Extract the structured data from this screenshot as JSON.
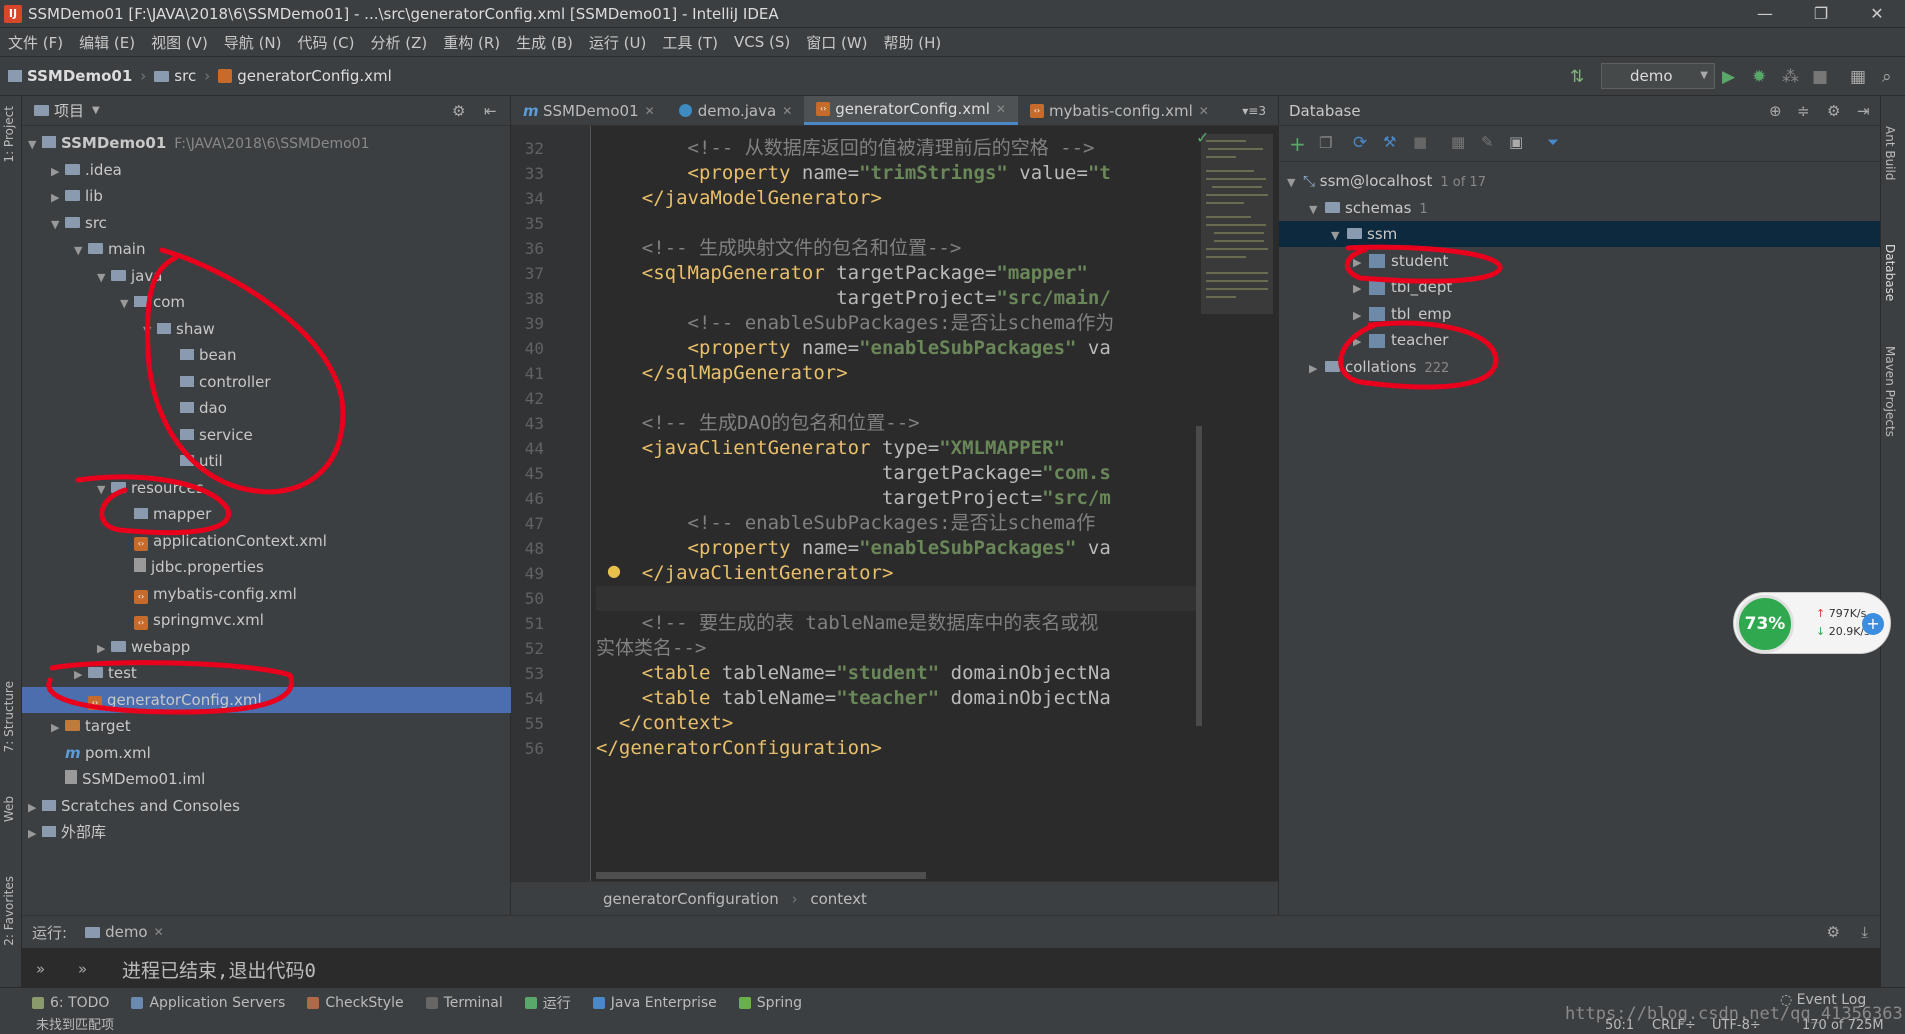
{
  "titlebar": {
    "icon": "IJ",
    "title": "SSMDemo01 [F:\\JAVA\\2018\\6\\SSMDemo01] - ...\\src\\generatorConfig.xml [SSMDemo01] - IntelliJ IDEA",
    "minimize": "—",
    "maximize": "❐",
    "close": "✕"
  },
  "menubar": [
    "文件 (F)",
    "编辑 (E)",
    "视图 (V)",
    "导航 (N)",
    "代码 (C)",
    "分析 (Z)",
    "重构 (R)",
    "生成 (B)",
    "运行 (U)",
    "工具 (T)",
    "VCS (S)",
    "窗口 (W)",
    "帮助 (H)"
  ],
  "navbar": {
    "crumbs": [
      "SSMDemo01",
      "src",
      "generatorConfig.xml"
    ],
    "run_config": "demo"
  },
  "left_stripe": {
    "project": "1: Project",
    "structure": "7: Structure",
    "web": "Web",
    "favorites": "2: Favorites"
  },
  "project_panel": {
    "title": "项目",
    "tree": [
      {
        "label": "SSMDemo01",
        "extra": "F:\\JAVA\\2018\\6\\SSMDemo01",
        "depth": 0,
        "arrow": "▼",
        "icon": "project-folder"
      },
      {
        "label": ".idea",
        "depth": 1,
        "arrow": "▶",
        "icon": "folder"
      },
      {
        "label": "lib",
        "depth": 1,
        "arrow": "▶",
        "icon": "folder"
      },
      {
        "label": "src",
        "depth": 1,
        "arrow": "▼",
        "icon": "folder"
      },
      {
        "label": "main",
        "depth": 2,
        "arrow": "▼",
        "icon": "folder"
      },
      {
        "label": "java",
        "depth": 3,
        "arrow": "▼",
        "icon": "folder"
      },
      {
        "label": "com",
        "depth": 4,
        "arrow": "▼",
        "icon": "package"
      },
      {
        "label": "shaw",
        "depth": 5,
        "arrow": "▼",
        "icon": "package"
      },
      {
        "label": "bean",
        "depth": 6,
        "arrow": "",
        "icon": "package"
      },
      {
        "label": "controller",
        "depth": 6,
        "arrow": "",
        "icon": "package"
      },
      {
        "label": "dao",
        "depth": 6,
        "arrow": "",
        "icon": "package"
      },
      {
        "label": "service",
        "depth": 6,
        "arrow": "",
        "icon": "package"
      },
      {
        "label": "util",
        "depth": 6,
        "arrow": "",
        "icon": "package"
      },
      {
        "label": "resources",
        "depth": 3,
        "arrow": "▼",
        "icon": "folder"
      },
      {
        "label": "mapper",
        "depth": 4,
        "arrow": "",
        "icon": "package"
      },
      {
        "label": "applicationContext.xml",
        "depth": 4,
        "arrow": "",
        "icon": "xml"
      },
      {
        "label": "jdbc.properties",
        "depth": 4,
        "arrow": "",
        "icon": "file"
      },
      {
        "label": "mybatis-config.xml",
        "depth": 4,
        "arrow": "",
        "icon": "xml"
      },
      {
        "label": "springmvc.xml",
        "depth": 4,
        "arrow": "",
        "icon": "xml"
      },
      {
        "label": "webapp",
        "depth": 3,
        "arrow": "▶",
        "icon": "folder"
      },
      {
        "label": "test",
        "depth": 2,
        "arrow": "▶",
        "icon": "folder"
      },
      {
        "label": "generatorConfig.xml",
        "depth": 2,
        "arrow": "",
        "icon": "xml",
        "selected": true
      },
      {
        "label": "target",
        "depth": 1,
        "arrow": "▶",
        "icon": "folder-orange"
      },
      {
        "label": "pom.xml",
        "depth": 1,
        "arrow": "",
        "icon": "maven"
      },
      {
        "label": "SSMDemo01.iml",
        "depth": 1,
        "arrow": "",
        "icon": "file"
      },
      {
        "label": "Scratches and Consoles",
        "depth": 0,
        "arrow": "▶",
        "icon": "scratches"
      },
      {
        "label": "外部库",
        "depth": 0,
        "arrow": "▶",
        "icon": "library"
      }
    ]
  },
  "editor": {
    "tabs": [
      {
        "label": "SSMDemo01",
        "icon": "m",
        "active": false
      },
      {
        "label": "demo.java",
        "icon": "class",
        "active": false
      },
      {
        "label": "generatorConfig.xml",
        "icon": "xml",
        "active": true
      },
      {
        "label": "mybatis-config.xml",
        "icon": "xml",
        "active": false
      }
    ],
    "tab_overflow": "▾≡3",
    "first_line_number": 32,
    "line_numbers": [
      "32",
      "33",
      "34",
      "35",
      "36",
      "37",
      "38",
      "39",
      "40",
      "41",
      "42",
      "43",
      "44",
      "45",
      "46",
      "47",
      "48",
      "49",
      "50",
      "51",
      "52",
      "53",
      "54",
      "55",
      "56"
    ],
    "lines": [
      [
        {
          "t": "        ",
          "c": "attr"
        },
        {
          "t": "<!-- 从数据库返回的值被清理前后的空格 -->",
          "c": "cmt"
        }
      ],
      [
        {
          "t": "        ",
          "c": "attr"
        },
        {
          "t": "<property ",
          "c": "tagc"
        },
        {
          "t": "name=",
          "c": "attr"
        },
        {
          "t": "\"trimStrings\"",
          "c": "val"
        },
        {
          "t": " value=",
          "c": "attr"
        },
        {
          "t": "\"t",
          "c": "val"
        }
      ],
      [
        {
          "t": "    ",
          "c": "attr"
        },
        {
          "t": "</javaModelGenerator>",
          "c": "tagc"
        }
      ],
      [
        {
          "t": "",
          "c": "attr"
        }
      ],
      [
        {
          "t": "    ",
          "c": "attr"
        },
        {
          "t": "<!-- 生成映射文件的包名和位置-->",
          "c": "cmt"
        }
      ],
      [
        {
          "t": "    ",
          "c": "attr"
        },
        {
          "t": "<sqlMapGenerator ",
          "c": "tagc"
        },
        {
          "t": "targetPackage=",
          "c": "attr"
        },
        {
          "t": "\"mapper\"",
          "c": "val"
        }
      ],
      [
        {
          "t": "                     ",
          "c": "attr"
        },
        {
          "t": "targetProject=",
          "c": "attr"
        },
        {
          "t": "\"src/main/",
          "c": "val"
        }
      ],
      [
        {
          "t": "        ",
          "c": "attr"
        },
        {
          "t": "<!-- enableSubPackages:是否让schema作为",
          "c": "cmt"
        }
      ],
      [
        {
          "t": "        ",
          "c": "attr"
        },
        {
          "t": "<property ",
          "c": "tagc"
        },
        {
          "t": "name=",
          "c": "attr"
        },
        {
          "t": "\"enableSubPackages\"",
          "c": "val"
        },
        {
          "t": " va",
          "c": "attr"
        }
      ],
      [
        {
          "t": "    ",
          "c": "attr"
        },
        {
          "t": "</sqlMapGenerator>",
          "c": "tagc"
        }
      ],
      [
        {
          "t": "",
          "c": "attr"
        }
      ],
      [
        {
          "t": "    ",
          "c": "attr"
        },
        {
          "t": "<!-- 生成DAO的包名和位置-->",
          "c": "cmt"
        }
      ],
      [
        {
          "t": "    ",
          "c": "attr"
        },
        {
          "t": "<javaClientGenerator ",
          "c": "tagc"
        },
        {
          "t": "type=",
          "c": "attr"
        },
        {
          "t": "\"XMLMAPPER\"",
          "c": "val"
        }
      ],
      [
        {
          "t": "                         ",
          "c": "attr"
        },
        {
          "t": "targetPackage=",
          "c": "attr"
        },
        {
          "t": "\"com.s",
          "c": "val"
        }
      ],
      [
        {
          "t": "                         ",
          "c": "attr"
        },
        {
          "t": "targetProject=",
          "c": "attr"
        },
        {
          "t": "\"src/m",
          "c": "val"
        }
      ],
      [
        {
          "t": "        ",
          "c": "attr"
        },
        {
          "t": "<!-- enableSubPackages:是否让schema作",
          "c": "cmt"
        }
      ],
      [
        {
          "t": "        ",
          "c": "attr"
        },
        {
          "t": "<property ",
          "c": "tagc"
        },
        {
          "t": "name=",
          "c": "attr"
        },
        {
          "t": "\"enableSubPackages\"",
          "c": "val"
        },
        {
          "t": " va",
          "c": "attr"
        }
      ],
      [
        {
          "t": "    ",
          "c": "attr"
        },
        {
          "t": "</javaClientGenerator>",
          "c": "tagc"
        }
      ],
      [
        {
          "t": "",
          "c": "attr"
        }
      ],
      [
        {
          "t": "    ",
          "c": "attr"
        },
        {
          "t": "<!-- 要生成的表 tableName是数据库中的表名或视",
          "c": "cmt"
        }
      ],
      [
        {
          "t": "实体类名-->",
          "c": "cmt"
        }
      ],
      [
        {
          "t": "    ",
          "c": "attr"
        },
        {
          "t": "<table ",
          "c": "tagc"
        },
        {
          "t": "tableName=",
          "c": "attr"
        },
        {
          "t": "\"student\"",
          "c": "val"
        },
        {
          "t": " domainObjectNa",
          "c": "attr"
        }
      ],
      [
        {
          "t": "    ",
          "c": "attr"
        },
        {
          "t": "<table ",
          "c": "tagc"
        },
        {
          "t": "tableName=",
          "c": "attr"
        },
        {
          "t": "\"teacher\"",
          "c": "val"
        },
        {
          "t": " domainObjectNa",
          "c": "attr"
        }
      ],
      [
        {
          "t": "  ",
          "c": "attr"
        },
        {
          "t": "</context>",
          "c": "tagc"
        }
      ],
      [
        {
          "t": "</generatorConfiguration>",
          "c": "tagc"
        }
      ]
    ],
    "breadcrumb": [
      "generatorConfiguration",
      "context"
    ]
  },
  "database_panel": {
    "title": "Database",
    "tree": [
      {
        "label": "ssm@localhost",
        "extra": "1 of 17",
        "depth": 0,
        "arrow": "▼",
        "icon": "datasource"
      },
      {
        "label": "schemas",
        "extra": "1",
        "depth": 1,
        "arrow": "▼",
        "icon": "folder"
      },
      {
        "label": "ssm",
        "extra": "",
        "depth": 2,
        "arrow": "▼",
        "icon": "schema",
        "selected": true
      },
      {
        "label": "student",
        "extra": "",
        "depth": 3,
        "arrow": "▶",
        "icon": "table"
      },
      {
        "label": "tbl_dept",
        "extra": "",
        "depth": 3,
        "arrow": "▶",
        "icon": "table"
      },
      {
        "label": "tbl_emp",
        "extra": "",
        "depth": 3,
        "arrow": "▶",
        "icon": "table"
      },
      {
        "label": "teacher",
        "extra": "",
        "depth": 3,
        "arrow": "▶",
        "icon": "table"
      },
      {
        "label": "collations",
        "extra": "222",
        "depth": 1,
        "arrow": "▶",
        "icon": "folder"
      }
    ]
  },
  "right_stripe": {
    "ant": "Ant Build",
    "database": "Database",
    "maven": "Maven Projects"
  },
  "run_panel": {
    "label": "运行:",
    "tab": "demo",
    "output": "进程已结束,退出代码0"
  },
  "tool_windows": [
    "6: TODO",
    "Application Servers",
    "CheckStyle",
    "Terminal",
    "运行",
    "Java Enterprise",
    "Spring"
  ],
  "event_log": "Event Log",
  "status": {
    "message": "未找到匹配项",
    "position": "50:1",
    "line_sep": "CRLF÷",
    "encoding": "UTF-8÷",
    "memory": "170 of 725M"
  },
  "net_widget": {
    "percent": "73%",
    "up": "797K/s",
    "down": "20.9K/s",
    "plus": "+"
  },
  "watermark": "https://blog.csdn.net/qq_41356363",
  "colors": {
    "accent": "#4b6eaf",
    "annotation": "#e8001c",
    "run_green": "#59a869"
  }
}
